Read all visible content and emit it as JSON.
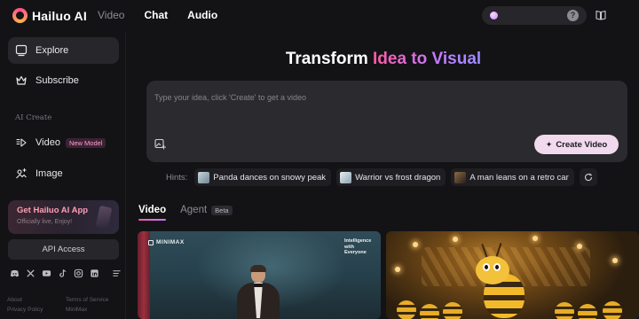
{
  "app": {
    "brand": "Hailuo AI",
    "colors": {
      "accent_pink": "#ff5aa5",
      "accent_purple": "#c47bff",
      "create_button": "#f1d9ee",
      "background": "#131316",
      "panel": "#2a2a2f"
    }
  },
  "topnav": {
    "items": [
      {
        "label": "Video",
        "state": "muted"
      },
      {
        "label": "Chat",
        "state": "active"
      },
      {
        "label": "Audio",
        "state": "active"
      }
    ],
    "credits_icon": "gem-icon",
    "help_icon": "help-icon",
    "docs_icon": "book-icon"
  },
  "sidebar": {
    "items": [
      {
        "label": "Explore",
        "icon": "explore-icon",
        "selected": true
      },
      {
        "label": "Subscribe",
        "icon": "crown-icon",
        "selected": false
      }
    ],
    "section_title": "AI Create",
    "create_items": [
      {
        "label": "Video",
        "icon": "video-icon",
        "badge": "New Model"
      },
      {
        "label": "Image",
        "icon": "image-icon"
      }
    ],
    "promo": {
      "title": "Get Hailuo AI App",
      "subtitle": "Officially live, Enjoy!"
    },
    "api_button": "API Access",
    "socials": [
      "discord-icon",
      "x-icon",
      "youtube-icon",
      "tiktok-icon",
      "instagram-icon",
      "linkedin-icon",
      "menu-icon"
    ],
    "footer": {
      "about": "About",
      "terms": "Terms of Service",
      "privacy": "Privacy Policy",
      "company": "MiniMax"
    }
  },
  "main": {
    "hero": {
      "title_plain": "Transform ",
      "title_gradient": "Idea to Visual"
    },
    "prompt": {
      "placeholder": "Type your idea, click 'Create' to get a video",
      "value": ""
    },
    "create_button": "Create Video",
    "hints": {
      "label": "Hints:",
      "items": [
        {
          "label": "Panda dances on snowy peak",
          "thumb_color": "#8fa6b3"
        },
        {
          "label": "Warrior vs frost dragon",
          "thumb_color": "#b9c7cf"
        },
        {
          "label": "A man leans on a retro car",
          "thumb_color": "#5a4634"
        }
      ],
      "refresh_icon": "refresh-icon"
    },
    "tabs": [
      {
        "label": "Video",
        "active": true
      },
      {
        "label": "Agent",
        "badge": "Beta",
        "active": false
      }
    ],
    "cards": [
      {
        "brand": "MINIMAX",
        "tagline": [
          "Intelligence",
          "with",
          "Everyone"
        ]
      },
      {
        "subject": "bee-scene"
      }
    ]
  }
}
